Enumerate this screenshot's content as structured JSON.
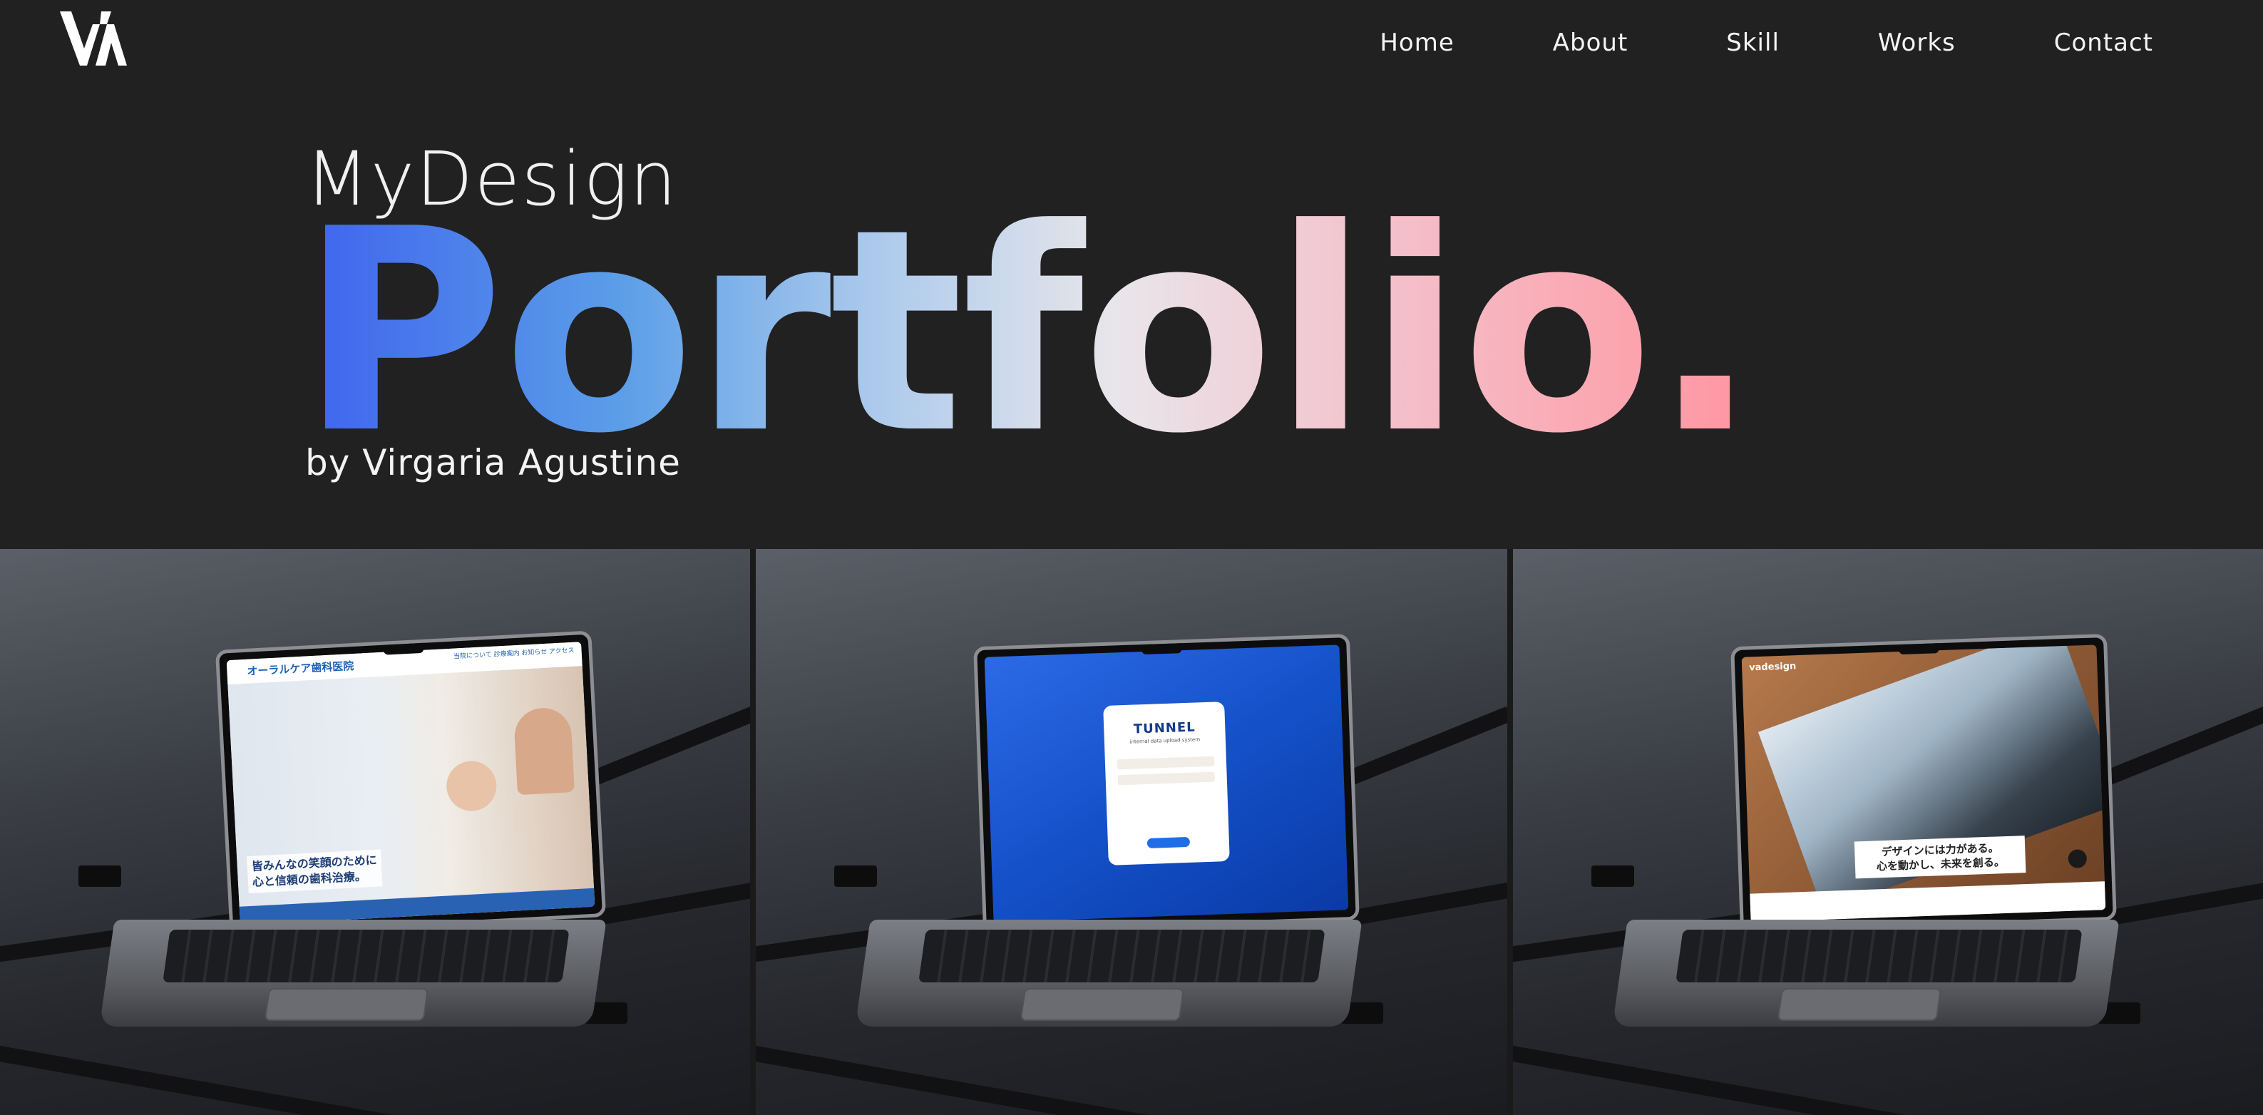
{
  "header": {
    "logo_text": "VA",
    "nav": [
      "Home",
      "About",
      "Skill",
      "Works",
      "Contact"
    ]
  },
  "hero": {
    "supertitle": "MyDesign",
    "title": "Portfolio.",
    "byline": "by Virgaria Agustine"
  },
  "works": [
    {
      "brand": "オーラルケア歯科医院",
      "menu": "当院について 診療案内 お知らせ アクセス",
      "tagline_line1": "皆みんなの笑顔のために",
      "tagline_line2": "心と信頼の歯科治療。"
    },
    {
      "brand": "TUNNEL",
      "subtitle": "internal data upload system"
    },
    {
      "brand": "vadesign",
      "tagline_line1": "デザインには力がある。",
      "tagline_line2": "心を動かし、未来を創る。"
    }
  ],
  "colors": {
    "background": "#212121",
    "gradient_start": "#3f63ee",
    "gradient_end": "#ff95a0"
  }
}
